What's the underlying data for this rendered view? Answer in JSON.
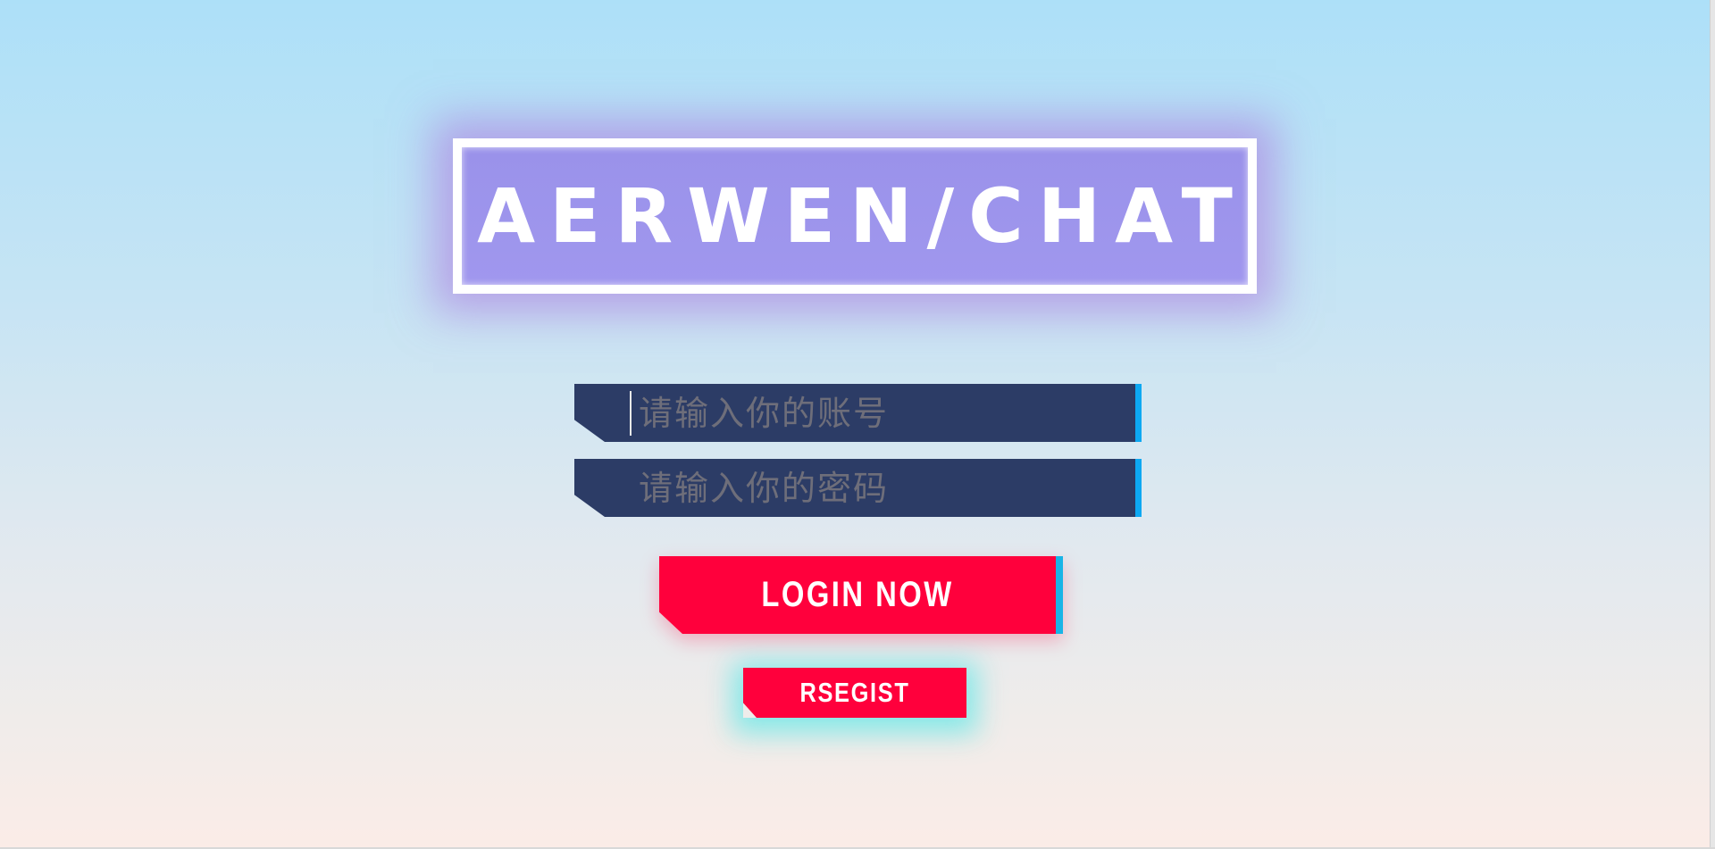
{
  "app": {
    "title": "AERWEN/CHAT"
  },
  "login_form": {
    "account_placeholder": "请输入你的账号",
    "password_placeholder": "请输入你的密码",
    "login_label": "LOGIN NOW",
    "register_label": "RSEGIST"
  },
  "colors": {
    "field_background": "#2c3c66",
    "field_accent": "#0da8f2",
    "button_red": "#ff003c",
    "banner_fill": "#9a92ea",
    "banner_glow": "#b06edc",
    "register_glow": "#50e6e6"
  }
}
